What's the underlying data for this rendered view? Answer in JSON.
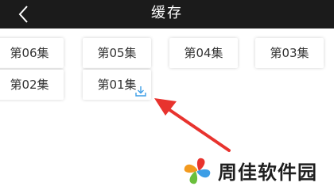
{
  "header": {
    "title": "缓存",
    "back_icon": "chevron-left-icon"
  },
  "episodes": [
    {
      "label": "第06集",
      "downloaded": false
    },
    {
      "label": "第05集",
      "downloaded": false
    },
    {
      "label": "第04集",
      "downloaded": false
    },
    {
      "label": "第03集",
      "downloaded": false
    },
    {
      "label": "第02集",
      "downloaded": false
    },
    {
      "label": "第01集",
      "downloaded": true,
      "status_icon": "download-icon"
    }
  ],
  "watermark": {
    "text": "周佳软件园"
  },
  "colors": {
    "top_bar": "#1b1b1b",
    "accent_blue": "#3d9ee6",
    "arrow_red": "#e8332e"
  }
}
